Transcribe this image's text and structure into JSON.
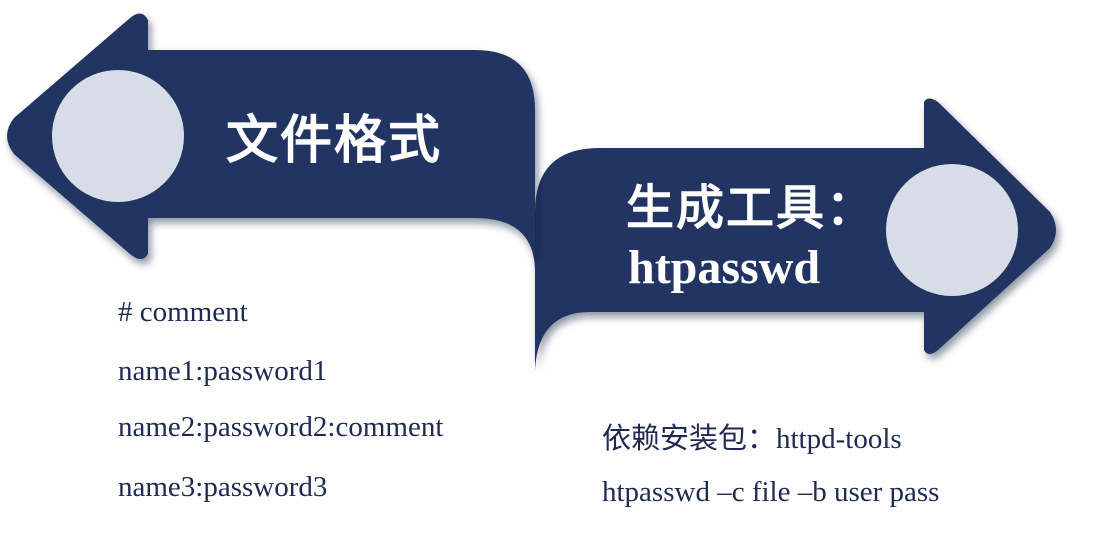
{
  "colors": {
    "arrow_fill": "#233462",
    "arrow_shadow": "#8c93a8",
    "circle_fill": "#d6dde7",
    "text_dark": "#1e2a52"
  },
  "left_arrow": {
    "title": "文件格式"
  },
  "right_arrow": {
    "title": "生成工具：",
    "subtitle": "htpasswd"
  },
  "format_lines": [
    "# comment",
    "name1:password1",
    "name2:password2:comment",
    "name3:password3"
  ],
  "tool_lines": [
    "依赖安装包：httpd-tools",
    "htpasswd –c file –b user pass"
  ]
}
